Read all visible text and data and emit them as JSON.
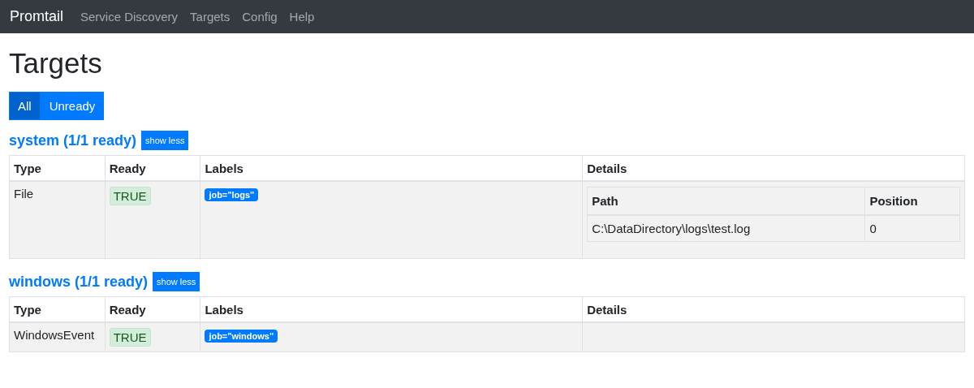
{
  "navbar": {
    "brand": "Promtail",
    "links": [
      {
        "label": "Service Discovery",
        "selected": false
      },
      {
        "label": "Targets",
        "selected": false
      },
      {
        "label": "Config",
        "selected": false
      },
      {
        "label": "Help",
        "selected": false
      }
    ]
  },
  "title": "Targets",
  "filters": [
    {
      "label": "All",
      "selected": true
    },
    {
      "label": "Unready",
      "selected": false
    }
  ],
  "pools": [
    {
      "heading": "system (1/1 ready)",
      "toggle": "show less",
      "columns": [
        "Type",
        "Ready",
        "Labels",
        "Details"
      ],
      "rows": [
        {
          "type": "File",
          "ready": {
            "text": "TRUE",
            "ok": true
          },
          "labels": [
            "job=\"logs\""
          ],
          "details": {
            "columns": [
              "Path",
              "Position"
            ],
            "rows": [
              [
                "C:\\DataDirectory\\logs\\test.log",
                "0"
              ]
            ]
          }
        }
      ]
    },
    {
      "heading": "windows (1/1 ready)",
      "toggle": "show less",
      "columns": [
        "Type",
        "Ready",
        "Labels",
        "Details"
      ],
      "rows": [
        {
          "type": "WindowsEvent",
          "ready": {
            "text": "TRUE",
            "ok": true
          },
          "labels": [
            "job=\"windows\""
          ]
        }
      ]
    }
  ]
}
